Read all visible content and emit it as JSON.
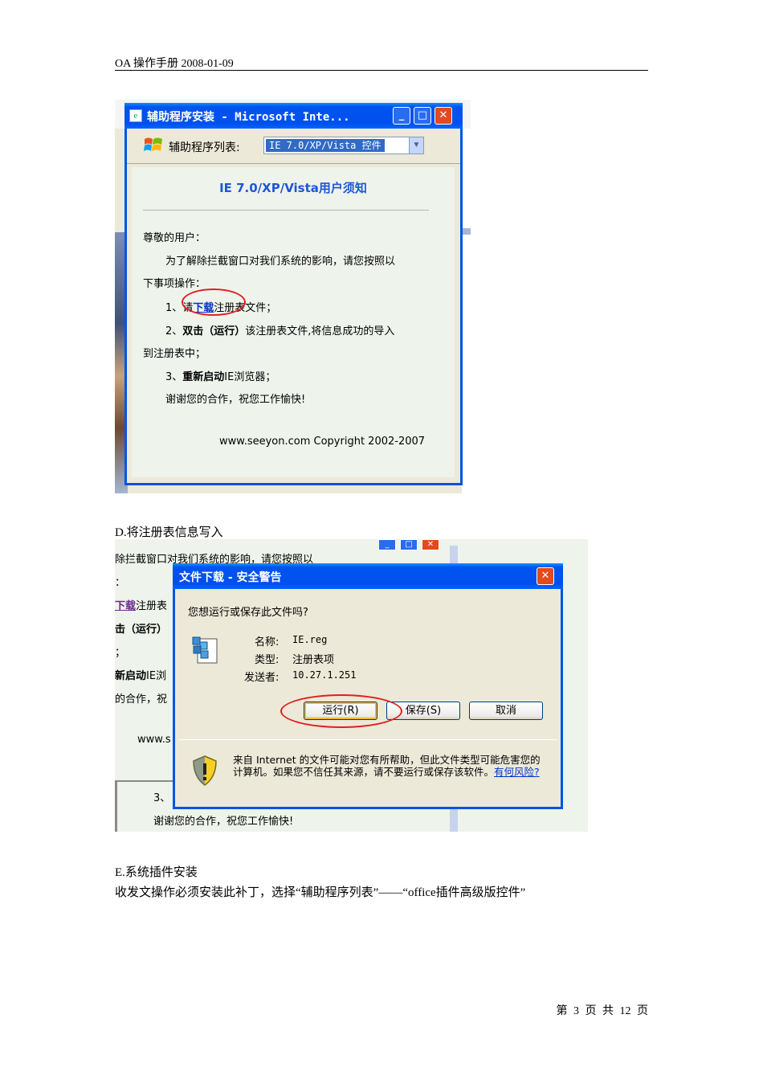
{
  "header": {
    "title": "OA 操作手册 2008-01-09"
  },
  "screenshot1": {
    "window_title": "辅助程序安装 - Microsoft Inte...",
    "title_buttons": {
      "minimize": "_",
      "maximize": "□",
      "close": "✕"
    },
    "toolbar_label": "辅助程序列表:",
    "select_value": "IE 7.0/XP/Vista 控件",
    "content_title": "IE 7.0/XP/Vista用户须知",
    "greeting": "尊敬的用户：",
    "para1_line1": "为了解除拦截窗口对我们系统的影响，请您按照以",
    "para1_line2": "下事项操作：",
    "step1_prefix": "1、请",
    "step1_link": "下载",
    "step1_suffix": "注册表文件；",
    "step2_prefix": "2、",
    "step2_bold": "双击（运行）",
    "step2_suffix": "该注册表文件,将信息成功的导入",
    "step2_line2": "到注册表中；",
    "step3_prefix": "3、",
    "step3_bold": "重新启动",
    "step3_suffix": "IE浏览器；",
    "thanks": "谢谢您的合作，祝您工作愉快!",
    "copyright": "www.seeyon.com Copyright 2002-2007"
  },
  "caption_d": "D.将注册表信息写入",
  "screenshot2": {
    "bg_line1": "除拦截窗口对我们系统的影响，请您按照以",
    "bg_line2": "：",
    "bg_line3_link": "下载",
    "bg_line3_suffix": "注册表",
    "bg_line4": "击（运行）",
    "bg_line5": "；",
    "bg_line6_bold": "新启动",
    "bg_line6_suffix": "IE浏",
    "bg_line7": "的合作，祝",
    "bg_line8": "www.s",
    "bg_line9": "3、",
    "bg_line10": "谢谢您的合作，祝您工作愉快!",
    "dialog_title": "文件下载 - 安全警告",
    "question": "您想运行或保存此文件吗?",
    "name_label": "名称:",
    "name_value": "IE.reg",
    "type_label": "类型:",
    "type_value": "注册表项",
    "from_label": "发送者:",
    "from_value": "10.27.1.251",
    "btn_run": "运行(R)",
    "btn_save": "保存(S)",
    "btn_cancel": "取消",
    "warning_text": "来自 Internet 的文件可能对您有所帮助，但此文件类型可能危害您的计算机。如果您不信任其来源，请不要运行或保存该软件。",
    "risk_link": "有何风险?",
    "close_btn": "✕"
  },
  "caption_e": "E.系统插件安装",
  "body_text": "收发文操作必须安装此补丁，选择“辅助程序列表”——“office插件高级版控件”",
  "footer": "第 3 页 共 12 页"
}
